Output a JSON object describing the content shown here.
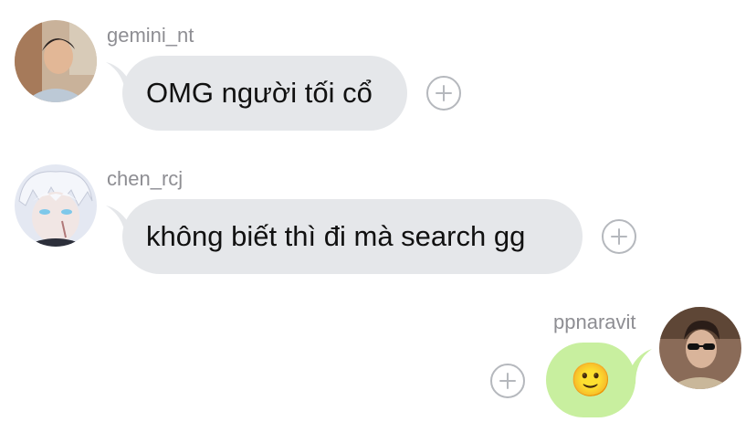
{
  "messages": [
    {
      "username": "gemini_nt",
      "text": "OMG người tối cổ",
      "direction": "incoming",
      "avatar_icon": "avatar-photo-man-icon"
    },
    {
      "username": "chen_rcj",
      "text": "không biết thì đi mà search gg",
      "direction": "incoming",
      "avatar_icon": "avatar-anime-character-icon"
    },
    {
      "username": "ppnaravit",
      "text": "🙂",
      "direction": "outgoing",
      "avatar_icon": "avatar-photo-sunglasses-icon"
    }
  ],
  "colors": {
    "incoming_bubble": "#e5e7ea",
    "outgoing_bubble": "#c8ef9f",
    "username": "#8e8e93",
    "reaction_button": "#b5b8bd"
  },
  "reaction_icon": "plus-icon"
}
